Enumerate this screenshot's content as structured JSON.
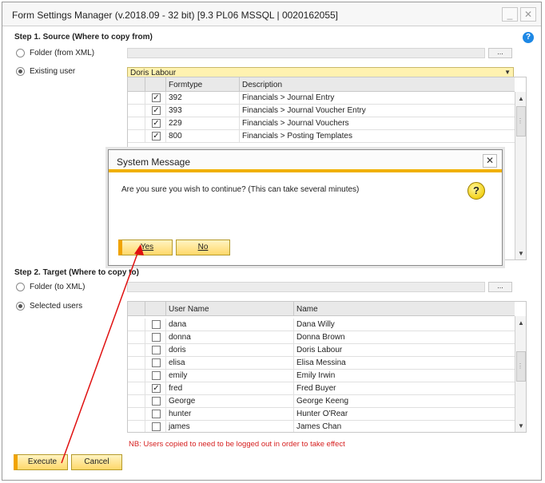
{
  "window": {
    "title": "Form Settings Manager (v.2018.09 - 32 bit) [9.3 PL06 MSSQL | 0020162055]",
    "minimize_label": "_",
    "close_label": "✕",
    "help_label": "?"
  },
  "step1": {
    "title": "Step 1. Source (Where to copy from)",
    "folder_label": "Folder (from XML)",
    "existing_user_label": "Existing user",
    "browse_label": "...",
    "selected_user": "Doris Labour",
    "selected_option": "existing_user",
    "grid": {
      "columns": [
        "",
        "",
        "Formtype",
        "Description"
      ],
      "rows": [
        {
          "checked": true,
          "formtype": "392",
          "description": "Financials > Journal Entry"
        },
        {
          "checked": true,
          "formtype": "393",
          "description": "Financials > Journal Voucher Entry"
        },
        {
          "checked": true,
          "formtype": "229",
          "description": "Financials > Journal Vouchers"
        },
        {
          "checked": true,
          "formtype": "800",
          "description": "Financials > Posting Templates"
        }
      ]
    }
  },
  "step2": {
    "title": "Step 2. Target (Where to copy to)",
    "folder_label": "Folder (to XML)",
    "selected_users_label": "Selected users",
    "browse_label": "...",
    "selected_option": "selected_users",
    "grid": {
      "columns": [
        "",
        "",
        "User Name",
        "Name"
      ],
      "rows": [
        {
          "checked": false,
          "username": "dana",
          "name": "Dana Willy"
        },
        {
          "checked": false,
          "username": "donna",
          "name": "Donna Brown"
        },
        {
          "checked": false,
          "username": "doris",
          "name": "Doris Labour"
        },
        {
          "checked": false,
          "username": "elisa",
          "name": "Elisa Messina"
        },
        {
          "checked": false,
          "username": "emily",
          "name": "Emily Irwin"
        },
        {
          "checked": true,
          "username": "fred",
          "name": "Fred Buyer"
        },
        {
          "checked": false,
          "username": "George",
          "name": "George Keeng"
        },
        {
          "checked": false,
          "username": "hunter",
          "name": "Hunter O'Rear"
        },
        {
          "checked": false,
          "username": "james",
          "name": "James Chan"
        }
      ]
    },
    "note": "NB: Users copied to need to be logged out in order to take effect"
  },
  "actions": {
    "execute_label": "Execute",
    "cancel_label": "Cancel"
  },
  "dialog": {
    "title": "System Message",
    "message": "Are you sure you wish to continue? (This can take several minutes)",
    "yes_label": "Yes",
    "no_label": "No",
    "icon_label": "?",
    "close_label": "✕"
  },
  "colors": {
    "accent": "#f0b000",
    "annotation_arrow": "#e01010",
    "help": "#1e88e5",
    "note": "#d62020"
  }
}
